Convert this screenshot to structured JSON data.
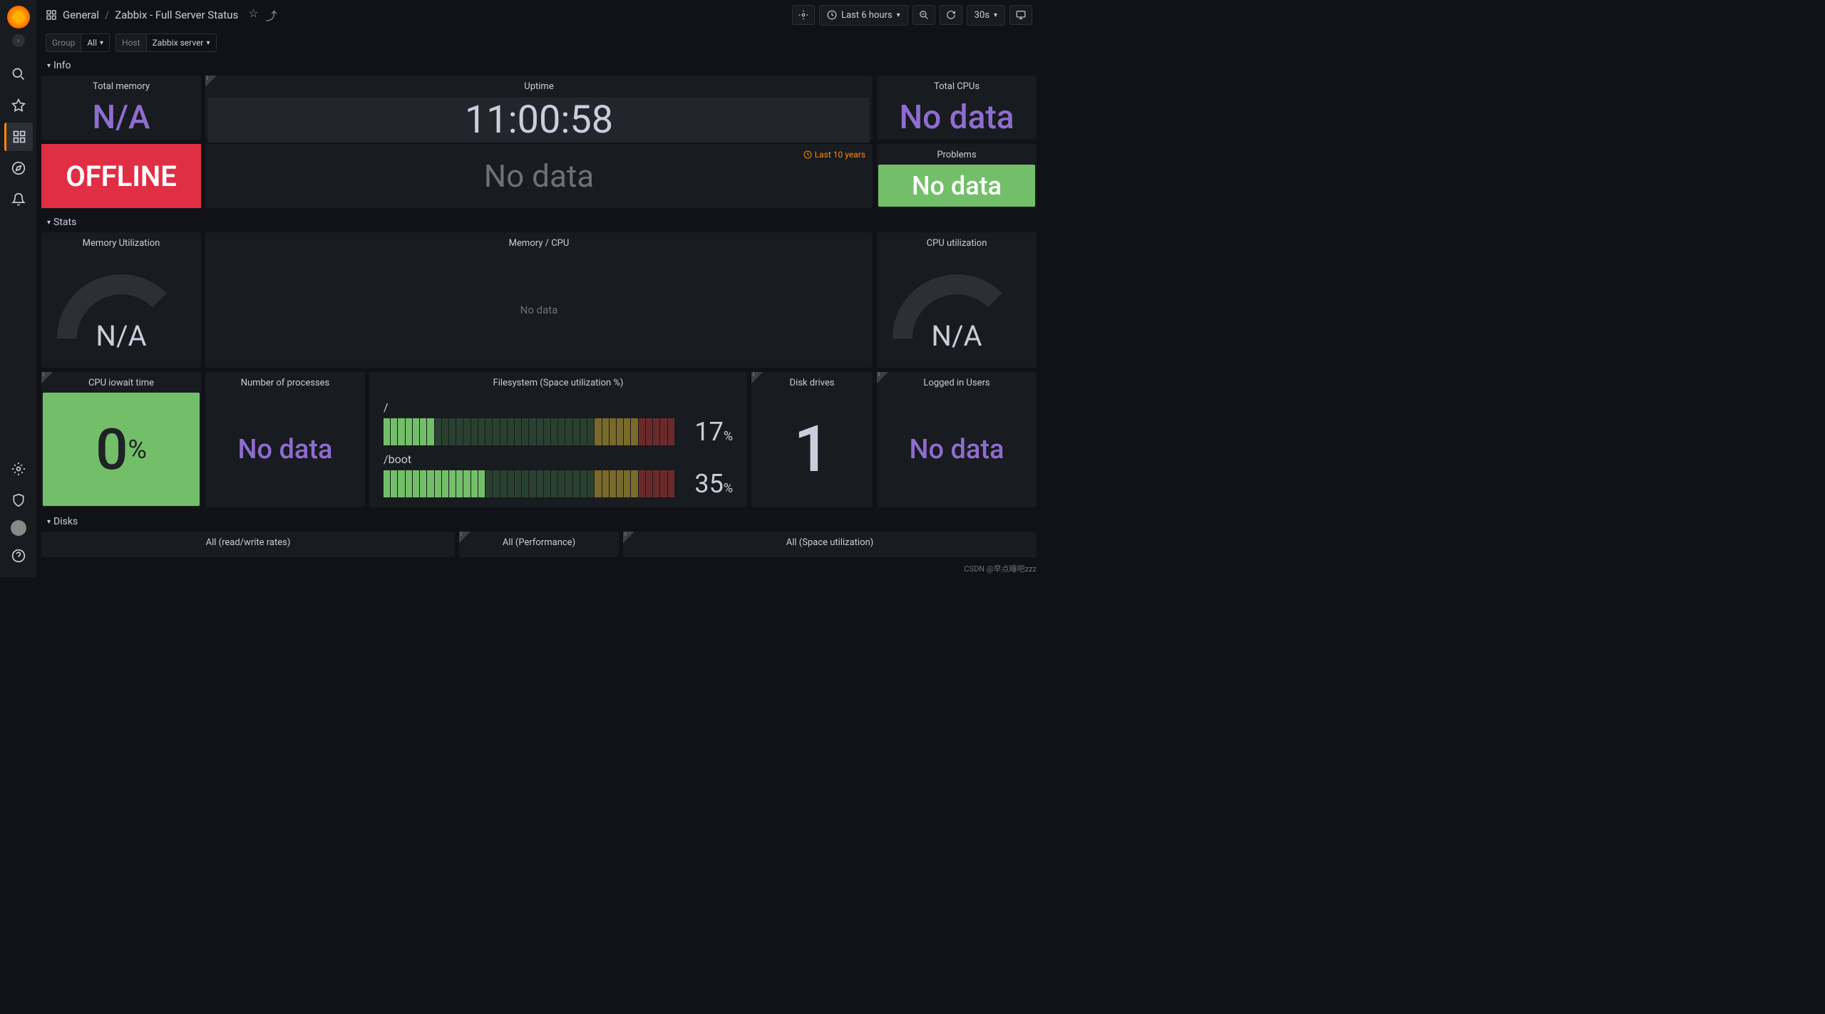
{
  "breadcrumb": {
    "icon": "dashboard",
    "folder": "General",
    "dashboard": "Zabbix - Full Server Status"
  },
  "topbar": {
    "time_range": "Last 6 hours",
    "refresh_interval": "30s"
  },
  "variables": {
    "group_label": "Group",
    "group_value": "All",
    "host_label": "Host",
    "host_value": "Zabbix server"
  },
  "sections": {
    "info": "Info",
    "stats": "Stats",
    "disks": "Disks"
  },
  "panels": {
    "total_memory": {
      "title": "Total memory",
      "value": "N/A"
    },
    "uptime": {
      "title": "Uptime",
      "value": "11:00:58"
    },
    "total_cpus": {
      "title": "Total CPUs",
      "value": "No data"
    },
    "offline": {
      "value": "OFFLINE"
    },
    "middle_nodata": {
      "note": "Last 10 years",
      "value": "No data"
    },
    "problems": {
      "title": "Problems",
      "value": "No data"
    },
    "mem_util": {
      "title": "Memory Utilization",
      "value": "N/A"
    },
    "mem_cpu": {
      "title": "Memory / CPU",
      "value": "No data"
    },
    "cpu_util": {
      "title": "CPU utilization",
      "value": "N/A"
    },
    "cpu_iowait": {
      "title": "CPU iowait time",
      "value": "0",
      "unit": "%"
    },
    "num_proc": {
      "title": "Number of processes",
      "value": "No data"
    },
    "fs": {
      "title": "Filesystem (Space utilization %)"
    },
    "disk_drives": {
      "title": "Disk drives",
      "value": "1"
    },
    "logged_users": {
      "title": "Logged in Users",
      "value": "No data"
    },
    "all_rw": {
      "title": "All (read/write rates)"
    },
    "all_perf": {
      "title": "All (Performance)"
    },
    "all_space": {
      "title": "All (Space utilization)"
    }
  },
  "chart_data": {
    "type": "bar",
    "title": "Filesystem (Space utilization %)",
    "categories": [
      "/",
      "/boot"
    ],
    "values": [
      17,
      35
    ],
    "ylim": [
      0,
      100
    ],
    "ylabel": "Space utilization %"
  },
  "watermark": "CSDN @早点睡吧zzz"
}
